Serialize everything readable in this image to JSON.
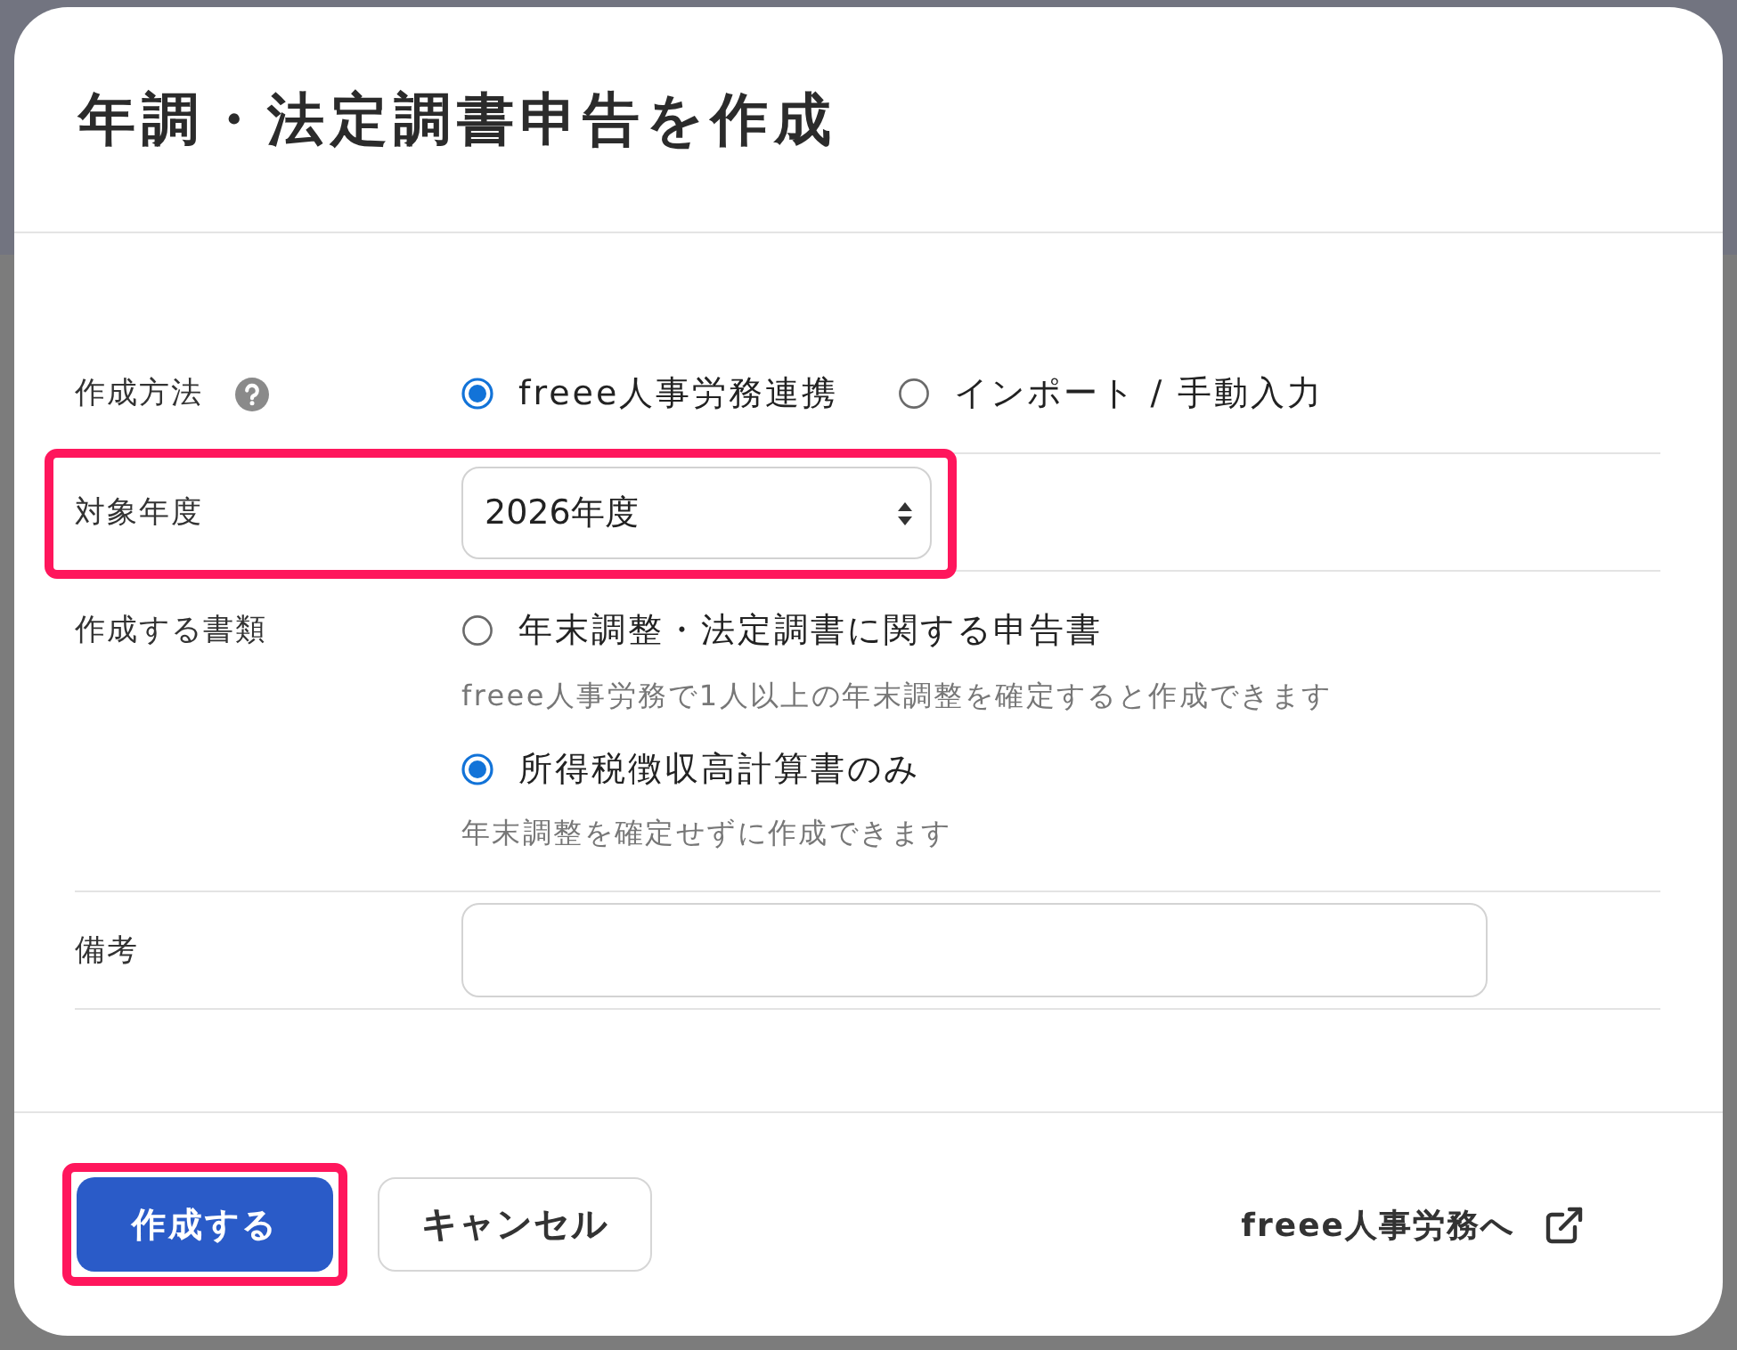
{
  "dialog": {
    "title": "年調・法定調書申告を作成"
  },
  "form": {
    "rows": [
      {
        "kind": "radio",
        "label": "作成方法",
        "help": true,
        "highlighted": false,
        "options": [
          {
            "label": "freee人事労務連携",
            "selected": true
          },
          {
            "label": "インポート / 手動入力",
            "selected": false
          }
        ]
      },
      {
        "kind": "select",
        "label": "対象年度",
        "value": "2026年度",
        "highlighted": true
      },
      {
        "kind": "radio-list",
        "label": "作成する書類",
        "highlighted": false,
        "options": [
          {
            "label": "年末調整・法定調書に関する申告書",
            "hint": "freee人事労務で1人以上の年末調整を確定すると作成できます",
            "selected": false
          },
          {
            "label": "所得税徴収高計算書のみ",
            "hint": "年末調整を確定せずに作成できます",
            "selected": true
          }
        ]
      },
      {
        "kind": "text",
        "label": "備考",
        "highlighted": false
      }
    ]
  },
  "footer": {
    "buttons": [
      {
        "kind": "primary",
        "label": "作成する",
        "highlighted": true
      },
      {
        "kind": "secondary",
        "label": "キャンセル",
        "highlighted": false
      }
    ],
    "link": {
      "label": "freee人事労務へ",
      "external": true
    }
  }
}
